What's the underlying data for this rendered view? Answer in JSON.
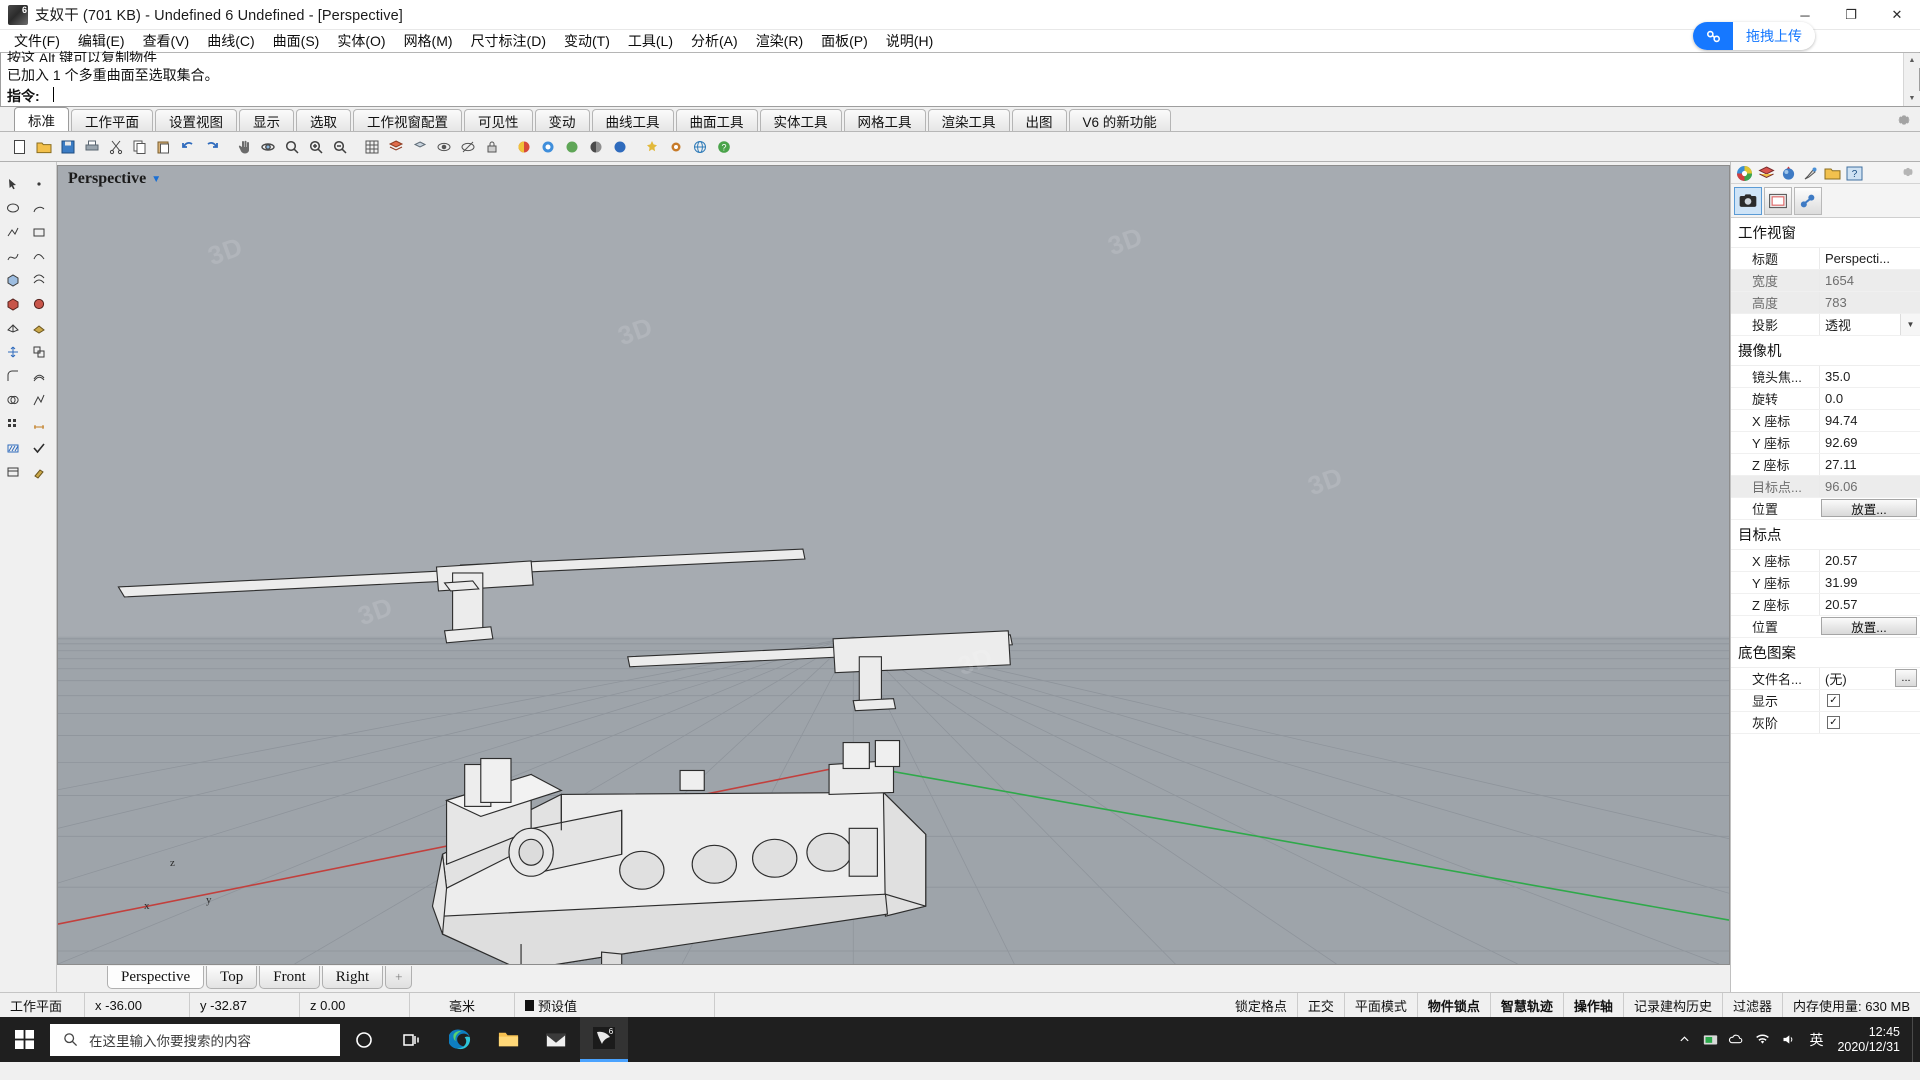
{
  "titlebar": {
    "title": "支奴干 (701 KB) - Undefined 6 Undefined - [Perspective]",
    "minimize": "─",
    "maximize": "❐",
    "close": "✕"
  },
  "menu": {
    "items": [
      {
        "label": "文件(F)"
      },
      {
        "label": "编辑(E)"
      },
      {
        "label": "查看(V)"
      },
      {
        "label": "曲线(C)"
      },
      {
        "label": "曲面(S)"
      },
      {
        "label": "实体(O)"
      },
      {
        "label": "网格(M)"
      },
      {
        "label": "尺寸标注(D)"
      },
      {
        "label": "变动(T)"
      },
      {
        "label": "工具(L)"
      },
      {
        "label": "分析(A)"
      },
      {
        "label": "渲染(R)"
      },
      {
        "label": "面板(P)"
      },
      {
        "label": "说明(H)"
      }
    ],
    "upload_label": "拖拽上传",
    "upload_accent": "#1678ff"
  },
  "command": {
    "history_line1": "按这 Alt 键可以复制物件",
    "history_line2": "已加入 1 个多重曲面至选取集合。",
    "prompt_label": "指令:",
    "prompt_value": ""
  },
  "toolbar_tabs": {
    "items": [
      {
        "label": "标准",
        "active": true
      },
      {
        "label": "工作平面",
        "active": false
      },
      {
        "label": "设置视图",
        "active": false
      },
      {
        "label": "显示",
        "active": false
      },
      {
        "label": "选取",
        "active": false
      },
      {
        "label": "工作视窗配置",
        "active": false
      },
      {
        "label": "可见性",
        "active": false
      },
      {
        "label": "变动",
        "active": false
      },
      {
        "label": "曲线工具",
        "active": false
      },
      {
        "label": "曲面工具",
        "active": false
      },
      {
        "label": "实体工具",
        "active": false
      },
      {
        "label": "网格工具",
        "active": false
      },
      {
        "label": "渲染工具",
        "active": false
      },
      {
        "label": "出图",
        "active": false
      },
      {
        "label": "V6 的新功能",
        "active": false
      }
    ]
  },
  "viewport": {
    "label": "Perspective",
    "tabs": [
      {
        "label": "Perspective",
        "active": true
      },
      {
        "label": "Top",
        "active": false
      },
      {
        "label": "Front",
        "active": false
      },
      {
        "label": "Right",
        "active": false
      }
    ],
    "add_tab": "+",
    "background_top": "#a3a8ae",
    "ground_color": "#9aa0a6",
    "x_axis_color": "#c2403d",
    "y_axis_color": "#2fa94a",
    "model_fill": "#e8e8e8",
    "axis_gizmo": {
      "z": "z",
      "y": "y",
      "x": "x"
    }
  },
  "right_panel": {
    "sections": [
      {
        "title": "工作视窗",
        "rows": [
          {
            "key": "标题",
            "value": "Perspecti...",
            "type": "text"
          },
          {
            "key": "宽度",
            "value": "1654",
            "type": "readonly"
          },
          {
            "key": "高度",
            "value": "783",
            "type": "readonly"
          },
          {
            "key": "投影",
            "value": "透视",
            "type": "dropdown"
          }
        ]
      },
      {
        "title": "摄像机",
        "rows": [
          {
            "key": "镜头焦...",
            "value": "35.0",
            "type": "text"
          },
          {
            "key": "旋转",
            "value": "0.0",
            "type": "text"
          },
          {
            "key": "X 座标",
            "value": "94.74",
            "type": "text"
          },
          {
            "key": "Y 座标",
            "value": "92.69",
            "type": "text"
          },
          {
            "key": "Z 座标",
            "value": "27.11",
            "type": "text"
          },
          {
            "key": "目标点...",
            "value": "96.06",
            "type": "readonly"
          },
          {
            "key": "位置",
            "value": "放置...",
            "type": "button"
          }
        ]
      },
      {
        "title": "目标点",
        "rows": [
          {
            "key": "X 座标",
            "value": "20.57",
            "type": "text"
          },
          {
            "key": "Y 座标",
            "value": "31.99",
            "type": "text"
          },
          {
            "key": "Z 座标",
            "value": "20.57",
            "type": "text"
          },
          {
            "key": "位置",
            "value": "放置...",
            "type": "button"
          }
        ]
      },
      {
        "title": "底色图案",
        "rows": [
          {
            "key": "文件名...",
            "value": "(无)",
            "type": "file"
          },
          {
            "key": "显示",
            "value": "✓",
            "type": "checkbox"
          },
          {
            "key": "灰阶",
            "value": "✓",
            "type": "checkbox"
          }
        ]
      }
    ]
  },
  "statusbar": {
    "cplane_label": "工作平面",
    "x": "x -36.00",
    "y": "y -32.87",
    "z": "z 0.00",
    "units": "毫米",
    "layer": "预设值",
    "toggles": [
      {
        "label": "锁定格点",
        "on": false
      },
      {
        "label": "正交",
        "on": false
      },
      {
        "label": "平面模式",
        "on": false
      },
      {
        "label": "物件锁点",
        "on": true
      },
      {
        "label": "智慧轨迹",
        "on": true
      },
      {
        "label": "操作轴",
        "on": true
      },
      {
        "label": "记录建构历史",
        "on": false
      },
      {
        "label": "过滤器",
        "on": false
      }
    ],
    "memory": "内存使用量: 630 MB"
  },
  "taskbar": {
    "search_placeholder": "在这里输入你要搜索的内容",
    "ime": "英",
    "time": "12:45",
    "date": "2020/12/31"
  }
}
